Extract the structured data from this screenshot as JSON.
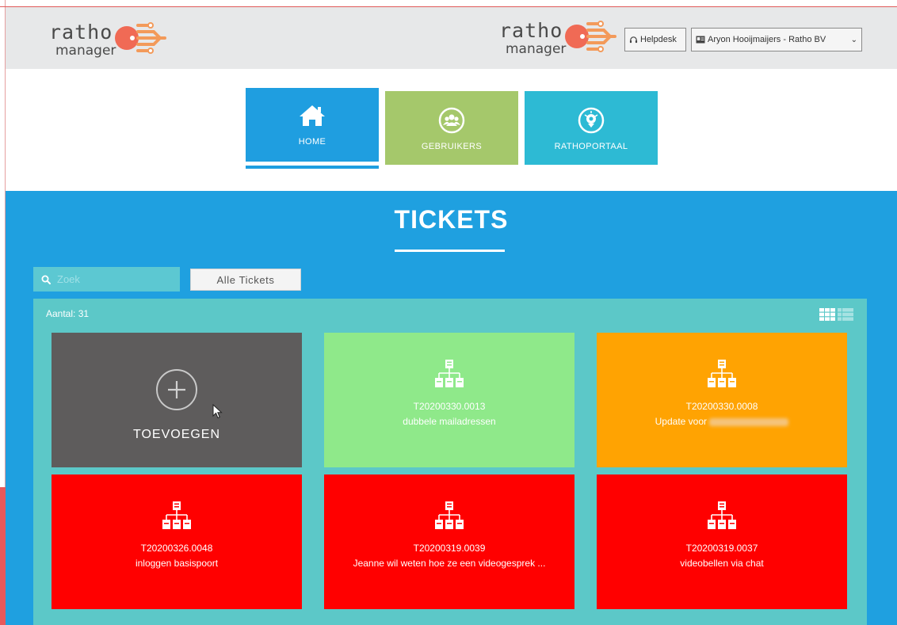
{
  "brand": {
    "name": "ratho",
    "sub": "manager"
  },
  "header": {
    "helpdesk_label": "Helpdesk",
    "user_label": "Aryon Hooijmaijers - Ratho BV"
  },
  "nav": [
    {
      "label": "HOME",
      "icon": "home-icon",
      "color": "#1f9ee0"
    },
    {
      "label": "GEBRUIKERS",
      "icon": "users-icon",
      "color": "#a5c86b"
    },
    {
      "label": "RATHOPORTAAL",
      "icon": "portal-icon",
      "color": "#2dbad4"
    }
  ],
  "main": {
    "title": "TICKETS",
    "search_placeholder": "Zoek",
    "filter_label": "Alle Tickets",
    "count_label": "Aantal: 31"
  },
  "add_card": {
    "label": "TOEVOEGEN",
    "icon": "plus-circle-icon"
  },
  "tickets": [
    {
      "id": "T20200330.0013",
      "subject": "dubbele mailadressen",
      "color": "#8fe98a"
    },
    {
      "id": "T20200330.0008",
      "subject": "Update voor",
      "subject_redacted": true,
      "color": "#ffa302"
    },
    {
      "id": "T20200326.0048",
      "subject": "inloggen basispoort",
      "color": "#ff0000"
    },
    {
      "id": "T20200319.0039",
      "subject": "Jeanne wil weten hoe ze een videogesprek ...",
      "color": "#ff0000"
    },
    {
      "id": "T20200319.0037",
      "subject": "videobellen via chat",
      "color": "#ff0000"
    }
  ],
  "colors": {
    "header_bg": "#e7e8e9",
    "main_bg": "#1fa0e0",
    "panel_bg": "#5cc8c8",
    "add_card_bg": "#5e5c5c"
  }
}
